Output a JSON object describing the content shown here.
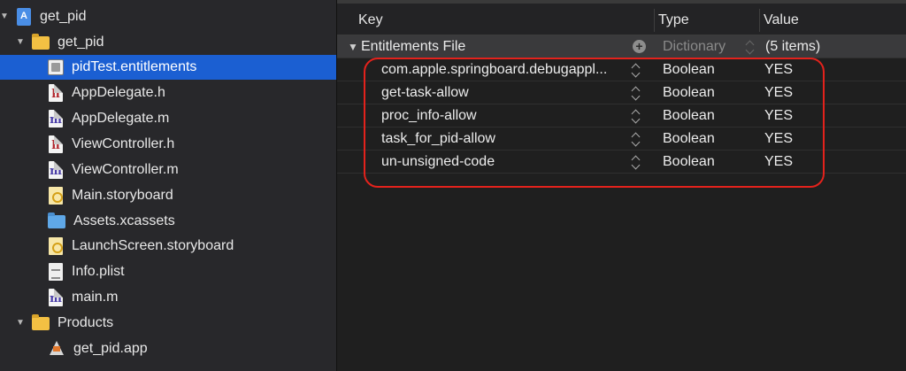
{
  "navigator": {
    "project": "get_pid",
    "group": "get_pid",
    "files": [
      {
        "label": "pidTest.entitlements",
        "icon": "entitlements-file-icon",
        "selected": true
      },
      {
        "label": "AppDelegate.h",
        "icon": "header-file-icon"
      },
      {
        "label": "AppDelegate.m",
        "icon": "objc-source-file-icon"
      },
      {
        "label": "ViewController.h",
        "icon": "header-file-icon"
      },
      {
        "label": "ViewController.m",
        "icon": "objc-source-file-icon"
      },
      {
        "label": "Main.storyboard",
        "icon": "storyboard-file-icon"
      },
      {
        "label": "Assets.xcassets",
        "icon": "asset-catalog-icon"
      },
      {
        "label": "LaunchScreen.storyboard",
        "icon": "storyboard-file-icon"
      },
      {
        "label": "Info.plist",
        "icon": "plist-file-icon"
      },
      {
        "label": "main.m",
        "icon": "objc-source-file-icon"
      }
    ],
    "products_group": "Products",
    "product": "get_pid.app",
    "icon_letters": {
      "header": "h",
      "source": "m"
    }
  },
  "plist": {
    "columns": {
      "key": "Key",
      "type": "Type",
      "value": "Value"
    },
    "root": {
      "key": "Entitlements File",
      "type": "Dictionary",
      "value": "(5 items)"
    },
    "items": [
      {
        "key": "com.apple.springboard.debugappl...",
        "type": "Boolean",
        "value": "YES"
      },
      {
        "key": "get-task-allow",
        "type": "Boolean",
        "value": "YES"
      },
      {
        "key": "proc_info-allow",
        "type": "Boolean",
        "value": "YES"
      },
      {
        "key": "task_for_pid-allow",
        "type": "Boolean",
        "value": "YES"
      },
      {
        "key": "un-unsigned-code",
        "type": "Boolean",
        "value": "YES"
      }
    ]
  },
  "colors": {
    "selection": "#1b5fd2",
    "annotation": "#e3221c",
    "navigator_bg": "#28282b",
    "editor_bg": "#1f1f1f"
  }
}
